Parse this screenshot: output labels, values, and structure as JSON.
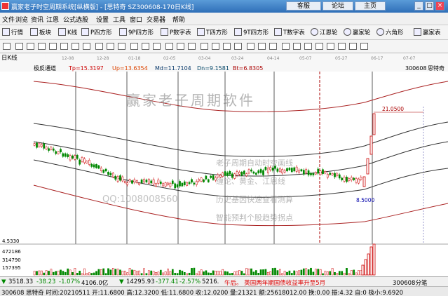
{
  "window": {
    "title": "赢家老子时空周期系统[纵横版] - [思特奇  SZ300608-170日K线]",
    "buttons": [
      "客服",
      "论坛",
      "主页"
    ]
  },
  "menu": [
    "文件",
    "浏览",
    "资讯",
    "江恩",
    "公式选股",
    "设置",
    "工具",
    "窗口",
    "交易器",
    "帮助"
  ],
  "toolbar1": [
    "行情",
    "板块",
    "K线",
    "P四方形",
    "9P四方形",
    "P数字表",
    "T四方形",
    "9T四方形",
    "T数字表",
    "江恩轮",
    "赢家轮",
    "六角形",
    "赢家表"
  ],
  "chart": {
    "tab": "日K线",
    "header_label": "极反通道",
    "tp": "Tp=15.3197",
    "up": "Up=13.6354",
    "md": "Md=11.7104",
    "dn": "Dn=9.1581",
    "bt": "Bt=6.8305",
    "code": "300608",
    "name_right": "思特奇",
    "price_high_label": "21.0500",
    "price_low_label": "8.5000",
    "watermark_title": "赢家老子周期软件",
    "watermark_lines": [
      "老子周期自动时空画线",
      "缠论、黄金、江恩线",
      "历史基因快速查看测算",
      "智能预判个股趋势拐点"
    ],
    "watermark_qq": "QQ:1008008560",
    "date_ticks": [
      "12-08",
      "12-28",
      "01-18",
      "02-05",
      "03-04",
      "03-24",
      "04-14",
      "05-07",
      "05-27",
      "06-17",
      "07-07"
    ],
    "volume_labels": [
      "4.5330",
      "472186",
      "314790",
      "157395"
    ]
  },
  "status1": {
    "idx1": "3518.33",
    "idx1_chg": "-38.23",
    "idx1_pct": "-1.07%",
    "idx1_amt": "4106.0亿",
    "idx2": "14295.93",
    "idx2_chg": "-377.41",
    "idx2_pct": "-2.57%",
    "idx2_amt": "5216.",
    "news": "午后。  英国两年期国债收益率升至5月",
    "cmd": "300608分笔"
  },
  "status2": "300608 思特奇 时间:20210511 开:11.6800 高:12.3200 低:11.6800 收:12.0200 量:21321 额:25618012.00 换:0.00 振:4.32 自:0 极小:9.6920"
}
